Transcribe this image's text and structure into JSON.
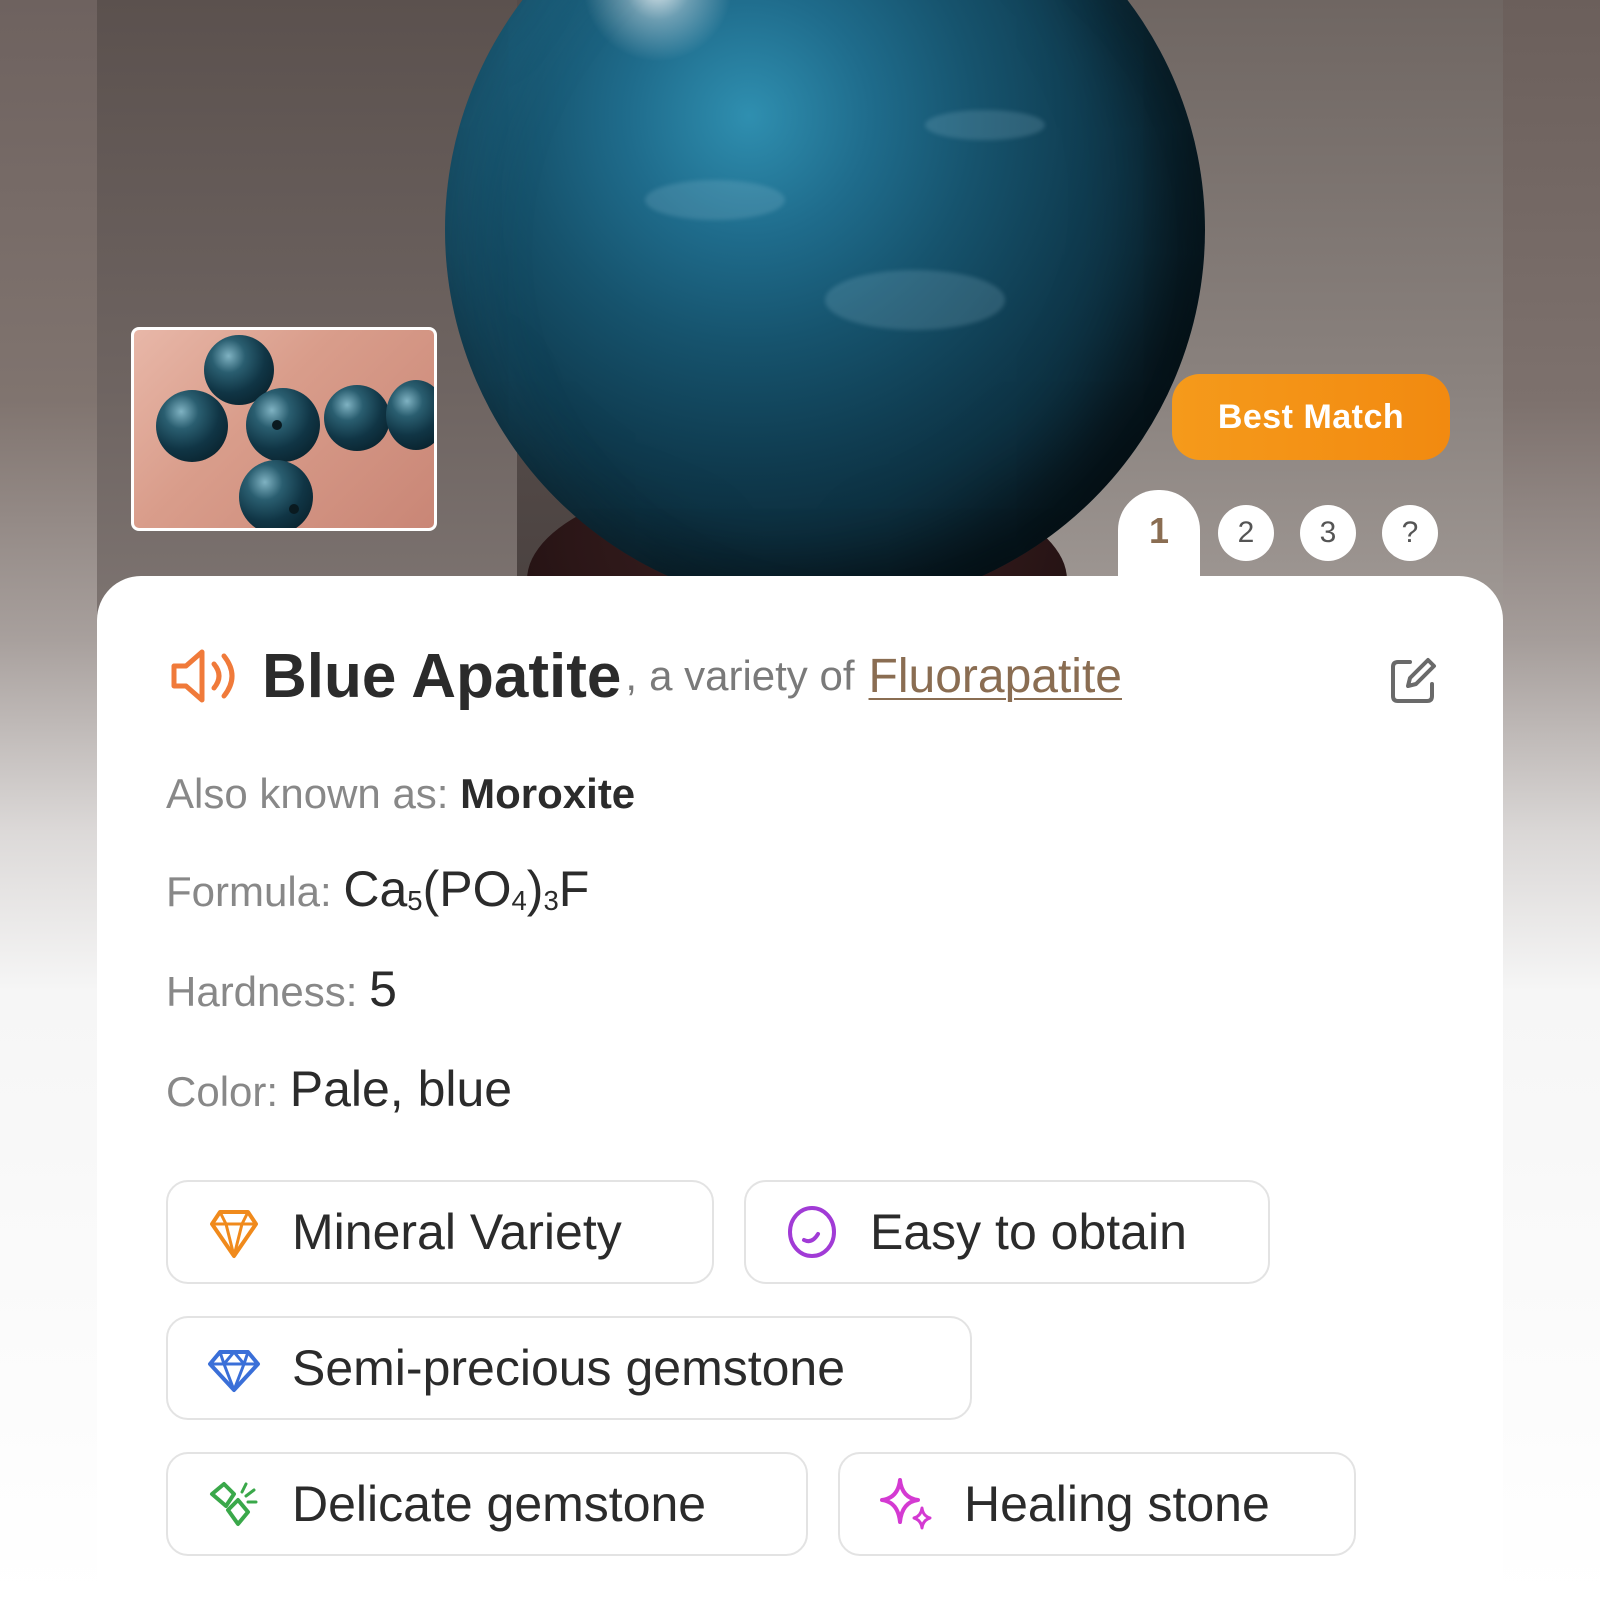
{
  "hero": {
    "badge": "Best Match",
    "tabs": [
      "1",
      "2",
      "3",
      "?"
    ],
    "active_tab": 0
  },
  "title": {
    "name": "Blue Apatite",
    "separator": ",",
    "variety_prefix": "a variety of",
    "parent_link": "Fluorapatite"
  },
  "properties": {
    "aka_label": "Also known as:",
    "aka_value": "Moroxite",
    "formula_label": "Formula:",
    "formula_parts": {
      "ca": "Ca",
      "ca_sub": "5",
      "open": "(PO",
      "o_sub": "4",
      "close": ")",
      "close_sub": "3",
      "f": "F"
    },
    "hardness_label": "Hardness:",
    "hardness_value": "5",
    "color_label": "Color:",
    "color_value": "Pale, blue"
  },
  "chips": [
    {
      "label": "Mineral Variety",
      "icon": "crystal-icon",
      "color": "#f08a1c"
    },
    {
      "label": "Easy to obtain",
      "icon": "stone-icon",
      "color": "#a13bd6"
    },
    {
      "label": "Semi-precious gemstone",
      "icon": "diamond-icon",
      "color": "#3a6fd8"
    },
    {
      "label": "Delicate gemstone",
      "icon": "broken-crystal-icon",
      "color": "#3aa84a"
    },
    {
      "label": "Healing stone",
      "icon": "sparkle-icon",
      "color": "#d43ad2"
    }
  ],
  "colors": {
    "accent_orange": "#f28a10",
    "link_brown": "#8a6d52",
    "speaker_orange": "#f07a3a"
  }
}
